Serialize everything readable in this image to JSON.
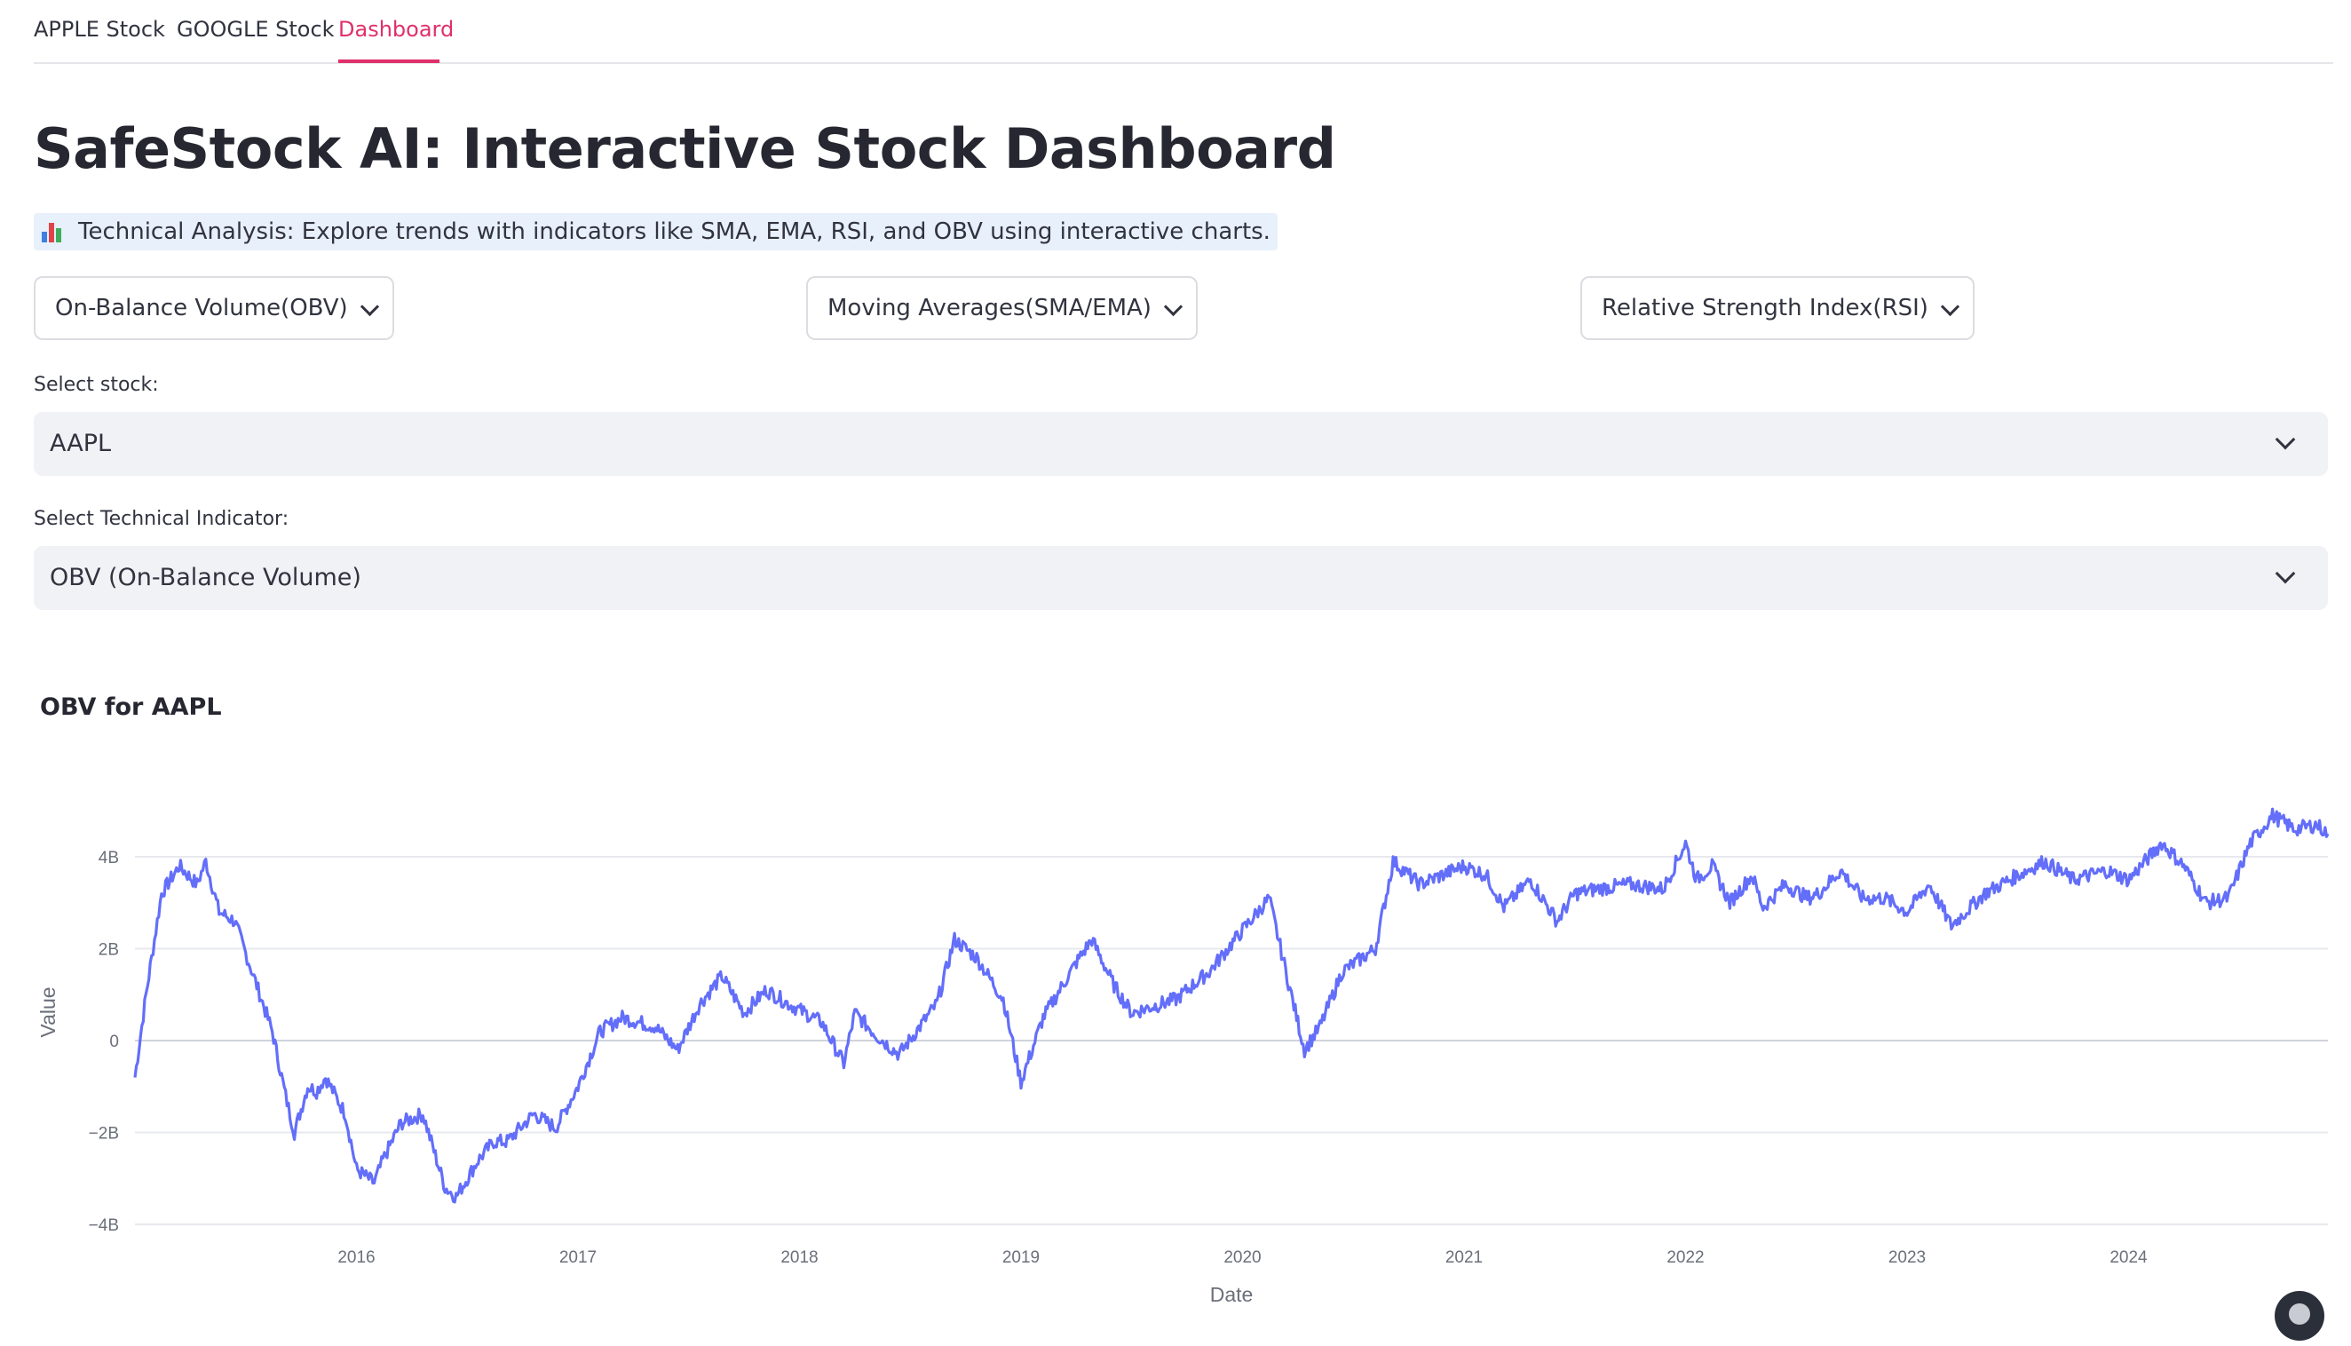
{
  "tabs": [
    {
      "label": "APPLE Stock",
      "active": false
    },
    {
      "label": "GOOGLE Stock",
      "active": false
    },
    {
      "label": "Dashboard",
      "active": true
    }
  ],
  "page": {
    "title": "SafeStock AI: Interactive Stock Dashboard",
    "info_icon": "bar-chart-emoji-icon",
    "info_text": "Technical Analysis: Explore trends with indicators like SMA, EMA, RSI, and OBV using interactive charts."
  },
  "expanders": [
    {
      "label": "On-Balance Volume(OBV)",
      "icon": "chevron-down-icon"
    },
    {
      "label": "Moving Averages(SMA/EMA)",
      "icon": "chevron-down-icon"
    },
    {
      "label": "Relative Strength Index(RSI)",
      "icon": "chevron-down-icon"
    }
  ],
  "stock_select": {
    "label": "Select stock:",
    "value": "AAPL"
  },
  "indicator_select": {
    "label": "Select Technical Indicator:",
    "value": "OBV (On-Balance Volume)"
  },
  "colors": {
    "accent": "#e0306a",
    "series": "#636efa",
    "info_bg": "#e8f0fb",
    "select_bg": "#f0f2f6"
  },
  "chart_data": {
    "type": "line",
    "title": "OBV for AAPL",
    "xlabel": "Date",
    "ylabel": "Value",
    "xlim": [
      2015.0,
      2024.9
    ],
    "ylim": [
      -4.0,
      4.8
    ],
    "y_unit": "billions",
    "yticks": [
      {
        "value": 4,
        "label": "4B"
      },
      {
        "value": 2,
        "label": "2B"
      },
      {
        "value": 0,
        "label": "0"
      },
      {
        "value": -2,
        "label": "−2B"
      },
      {
        "value": -4,
        "label": "−4B"
      }
    ],
    "xticks": [
      {
        "value": 2016,
        "label": "2016"
      },
      {
        "value": 2017,
        "label": "2017"
      },
      {
        "value": 2018,
        "label": "2018"
      },
      {
        "value": 2019,
        "label": "2019"
      },
      {
        "value": 2020,
        "label": "2020"
      },
      {
        "value": 2021,
        "label": "2021"
      },
      {
        "value": 2022,
        "label": "2022"
      },
      {
        "value": 2023,
        "label": "2023"
      },
      {
        "value": 2024,
        "label": "2024"
      }
    ],
    "grid": true,
    "series": [
      {
        "x": [
          2015.0,
          2015.05,
          2015.12,
          2015.2,
          2015.28,
          2015.32,
          2015.38,
          2015.45,
          2015.55,
          2015.62,
          2015.68,
          2015.72,
          2015.78,
          2015.82,
          2015.86,
          2015.95,
          2016.0,
          2016.08,
          2016.12,
          2016.2,
          2016.3,
          2016.4,
          2016.45,
          2016.55,
          2016.62,
          2016.68,
          2016.8,
          2016.9,
          2017.0,
          2017.1,
          2017.2,
          2017.35,
          2017.45,
          2017.55,
          2017.65,
          2017.75,
          2017.85,
          2017.95,
          2018.1,
          2018.2,
          2018.25,
          2018.35,
          2018.45,
          2018.62,
          2018.7,
          2018.8,
          2018.92,
          2019.0,
          2019.1,
          2019.25,
          2019.32,
          2019.42,
          2019.5,
          2019.7,
          2019.85,
          2020.0,
          2020.12,
          2020.22,
          2020.28,
          2020.35,
          2020.45,
          2020.6,
          2020.68,
          2020.8,
          2021.0,
          2021.1,
          2021.18,
          2021.3,
          2021.42,
          2021.5,
          2021.6,
          2021.75,
          2021.9,
          2022.0,
          2022.05,
          2022.12,
          2022.2,
          2022.3,
          2022.35,
          2022.45,
          2022.55,
          2022.6,
          2022.7,
          2022.8,
          2022.9,
          2023.0,
          2023.1,
          2023.2,
          2023.35,
          2023.5,
          2023.62,
          2023.75,
          2023.9,
          2024.0,
          2024.15,
          2024.25,
          2024.35,
          2024.45,
          2024.55,
          2024.65,
          2024.75,
          2024.85,
          2024.9
        ],
        "y": [
          -0.8,
          1.0,
          3.2,
          3.8,
          3.4,
          3.9,
          2.8,
          2.6,
          1.2,
          0.2,
          -1.2,
          -2.0,
          -1.0,
          -1.1,
          -0.8,
          -1.6,
          -2.8,
          -3.1,
          -2.6,
          -1.8,
          -1.6,
          -3.2,
          -3.4,
          -2.6,
          -2.2,
          -2.2,
          -1.6,
          -1.9,
          -1.0,
          0.2,
          0.5,
          0.3,
          -0.2,
          0.8,
          1.4,
          0.6,
          1.1,
          0.8,
          0.4,
          -0.5,
          0.6,
          0.1,
          -0.3,
          0.8,
          2.2,
          1.8,
          0.9,
          -0.9,
          0.5,
          1.7,
          2.2,
          1.2,
          0.6,
          0.9,
          1.5,
          2.4,
          3.1,
          1.0,
          -0.2,
          0.3,
          1.5,
          2.0,
          3.9,
          3.4,
          3.8,
          3.6,
          2.9,
          3.5,
          2.6,
          3.2,
          3.3,
          3.4,
          3.3,
          4.3,
          3.5,
          3.8,
          3.0,
          3.6,
          2.9,
          3.4,
          3.1,
          3.2,
          3.7,
          3.1,
          3.1,
          2.8,
          3.4,
          2.5,
          3.2,
          3.6,
          3.9,
          3.5,
          3.7,
          3.5,
          4.3,
          3.8,
          3.0,
          3.1,
          4.3,
          4.9,
          4.6,
          4.7,
          4.5
        ]
      }
    ]
  }
}
